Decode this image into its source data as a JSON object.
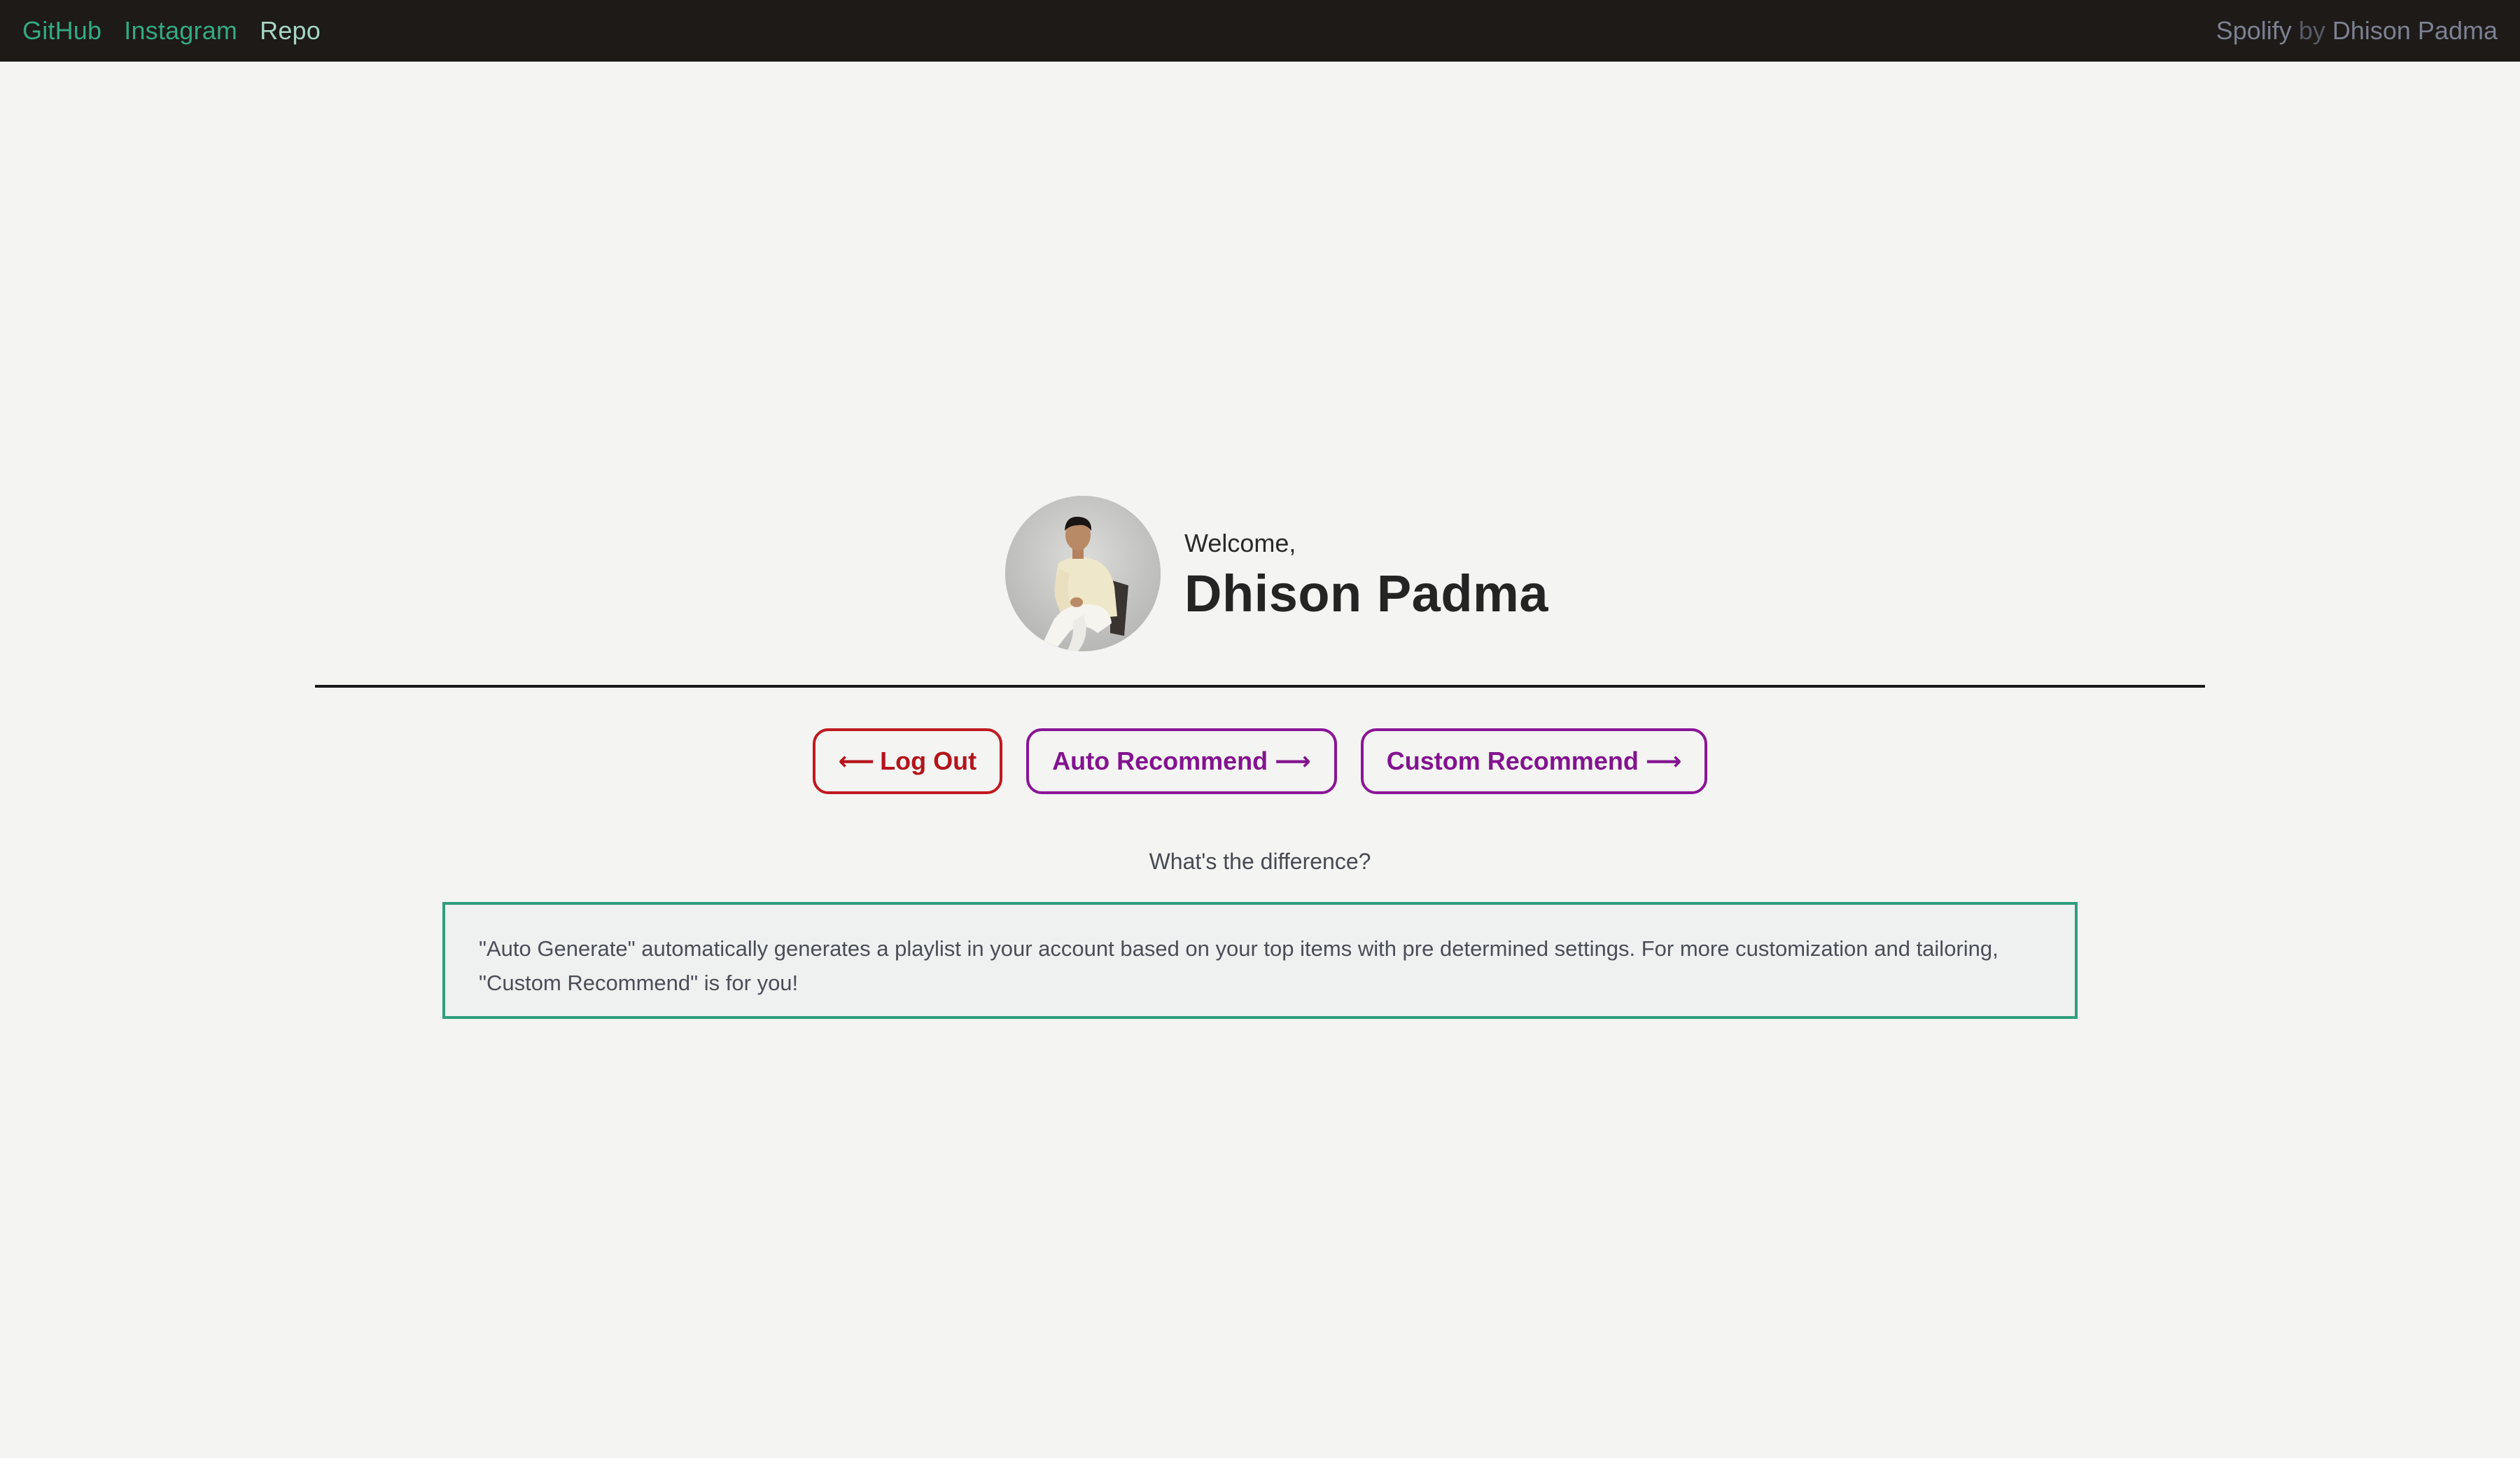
{
  "nav": {
    "links": [
      {
        "label": "GitHub",
        "color": "#34a983"
      },
      {
        "label": "Instagram",
        "color": "#34a983"
      },
      {
        "label": "Repo",
        "color": "#a6d6c4"
      }
    ],
    "brand": {
      "name": "Spolify",
      "by": "by",
      "author": "Dhison Padma"
    },
    "background": "#1d1a18"
  },
  "profile": {
    "welcome": "Welcome,",
    "name": "Dhison Padma",
    "avatar": "user-photo"
  },
  "actions": {
    "logout": {
      "arrow": "⟵",
      "label": "Log Out",
      "color": "#c0191f"
    },
    "auto": {
      "label": "Auto Recommend",
      "arrow": "⟶",
      "color": "#8a1596"
    },
    "custom": {
      "label": "Custom Recommend",
      "arrow": "⟶",
      "color": "#8a1596"
    }
  },
  "help": {
    "question": "What's the difference?",
    "explanation": "\"Auto Generate\" automatically generates a playlist in your account based on your top items with pre determined settings. For more customization and tailoring, \"Custom Recommend\" is for you!"
  },
  "colors": {
    "page_background": "#f4f4f3",
    "info_border": "#2f9e7e"
  }
}
